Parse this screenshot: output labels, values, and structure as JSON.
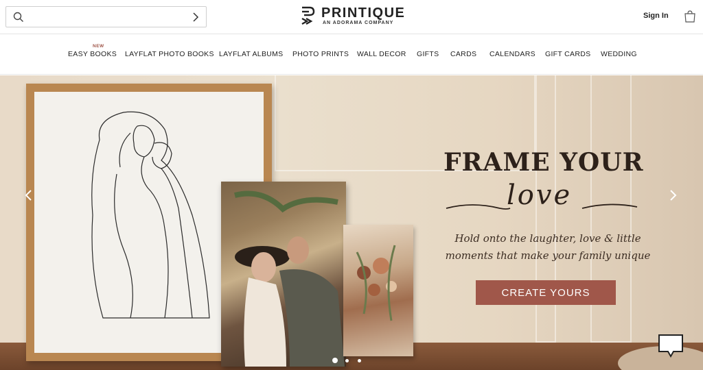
{
  "header": {
    "search_placeholder": "",
    "brand_name": "PRINTIQUE",
    "brand_tagline": "AN ADORAMA COMPANY",
    "sign_in_label": "Sign In"
  },
  "nav": {
    "items": [
      {
        "label": "EASY BOOKS",
        "badge": "NEW"
      },
      {
        "label": "LAYFLAT PHOTO BOOKS"
      },
      {
        "label": "LAYFLAT ALBUMS"
      },
      {
        "label": "PHOTO PRINTS"
      },
      {
        "label": "WALL DECOR"
      },
      {
        "label": "GIFTS"
      },
      {
        "label": "CARDS"
      },
      {
        "label": "CALENDARS"
      },
      {
        "label": "GIFT CARDS"
      },
      {
        "label": "WEDDING"
      }
    ]
  },
  "hero": {
    "headline": "FRAME YOUR",
    "script_word": "love",
    "subtext": "Hold onto the laughter, love & little moments that make your family unique",
    "cta_label": "CREATE YOURS",
    "slide_count": 3,
    "active_slide": 1
  },
  "colors": {
    "accent": "#a0574a",
    "text_dark": "#2d211a"
  },
  "icons": {
    "search": "search-icon",
    "submit": "chevron-right-icon",
    "bag": "shopping-bag-icon",
    "prev": "chevron-left-icon",
    "next": "chevron-right-icon",
    "chat": "chat-bubble-icon"
  }
}
